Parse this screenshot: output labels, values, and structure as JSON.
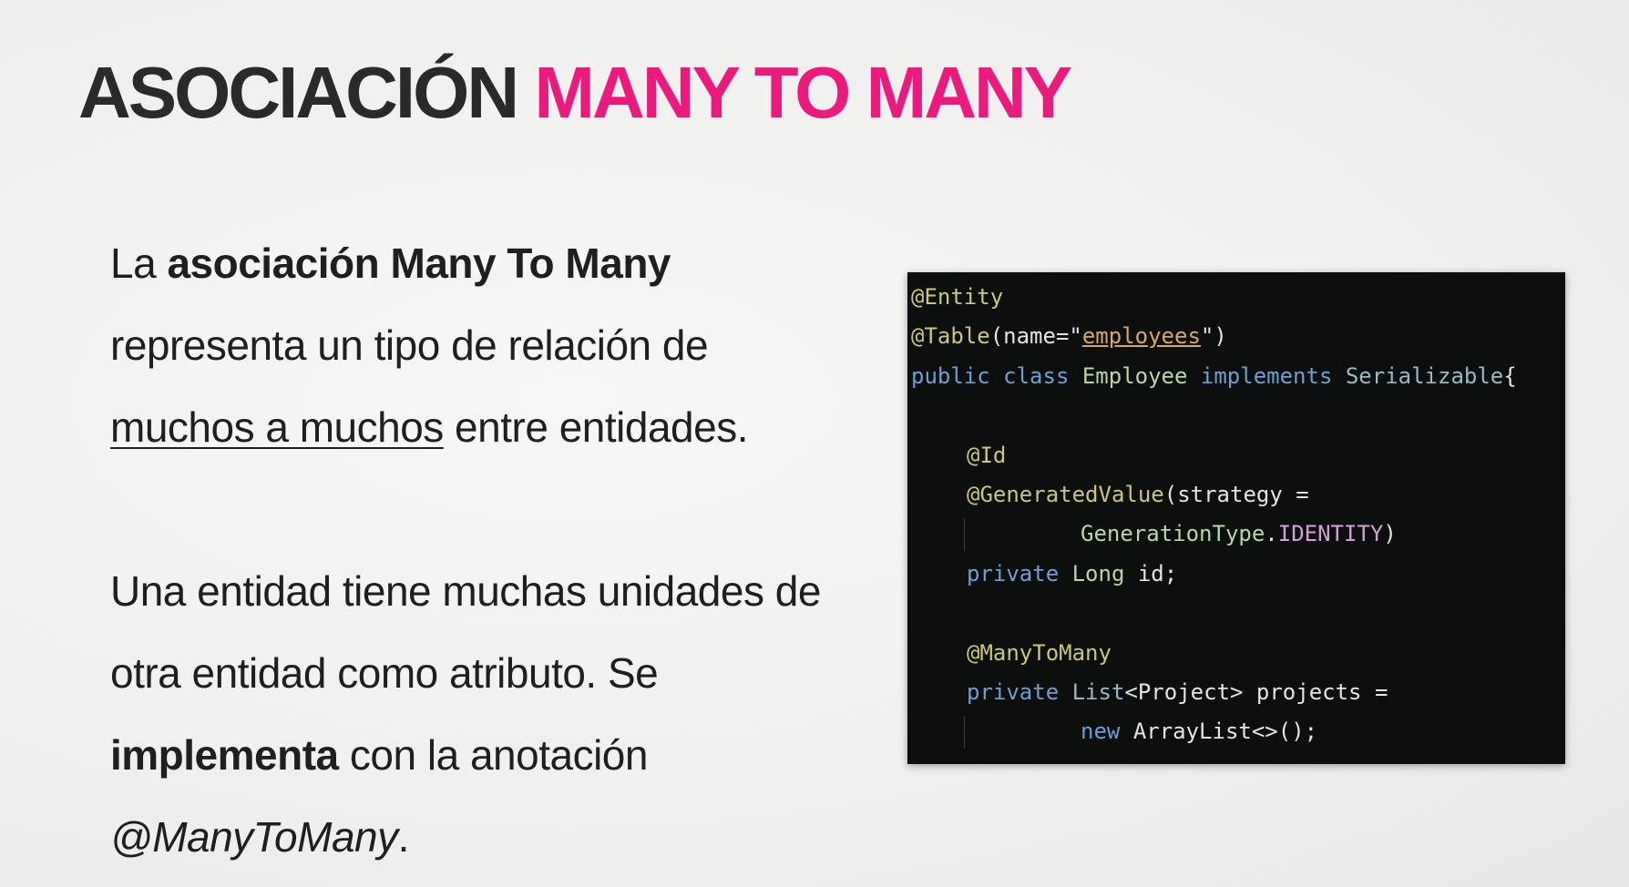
{
  "title": {
    "part1": "ASOCIACIÓN",
    "part2": "MANY TO MANY",
    "color_dark": "#2a2a2a",
    "color_accent": "#ec1a7d"
  },
  "body": {
    "p1_a": "La ",
    "p1_bold": "asociación Many To Many",
    "p1_b": " representa un tipo de relación de ",
    "p1_underline": "muchos a muchos",
    "p1_c": " entre entidades.",
    "p2_a": "Una entidad tiene muchas unidades de otra entidad como atributo. Se ",
    "p2_bold": "implementa",
    "p2_b": " con la anotación ",
    "p2_italic": "@ManyToMany",
    "p2_c": "."
  },
  "code": {
    "l1": "@Entity",
    "l2_ann": "@Table",
    "l2_a": "(name=\"",
    "l2_str": "employees",
    "l2_b": "\")",
    "l3_kw1": "public",
    "l3_kw2": "class",
    "l3_cls": "Employee",
    "l3_kw3": "implements",
    "l3_iface": "Serializable",
    "l3_brace": "{",
    "l5": "@Id",
    "l6_ann": "@GeneratedValue",
    "l6_rest": "(strategy =",
    "l7_cls": "GenerationType",
    "l7_dot": ".",
    "l7_const": "IDENTITY",
    "l7_end": ")",
    "l8_kw": "private",
    "l8_type": "Long",
    "l8_rest": "id;",
    "l10": "@ManyToMany",
    "l11_kw": "private",
    "l11_type": "List",
    "l11_gen": "<Project>",
    "l11_rest": "projects =",
    "l12_kw": "new",
    "l12_rest": "ArrayList<>();"
  }
}
